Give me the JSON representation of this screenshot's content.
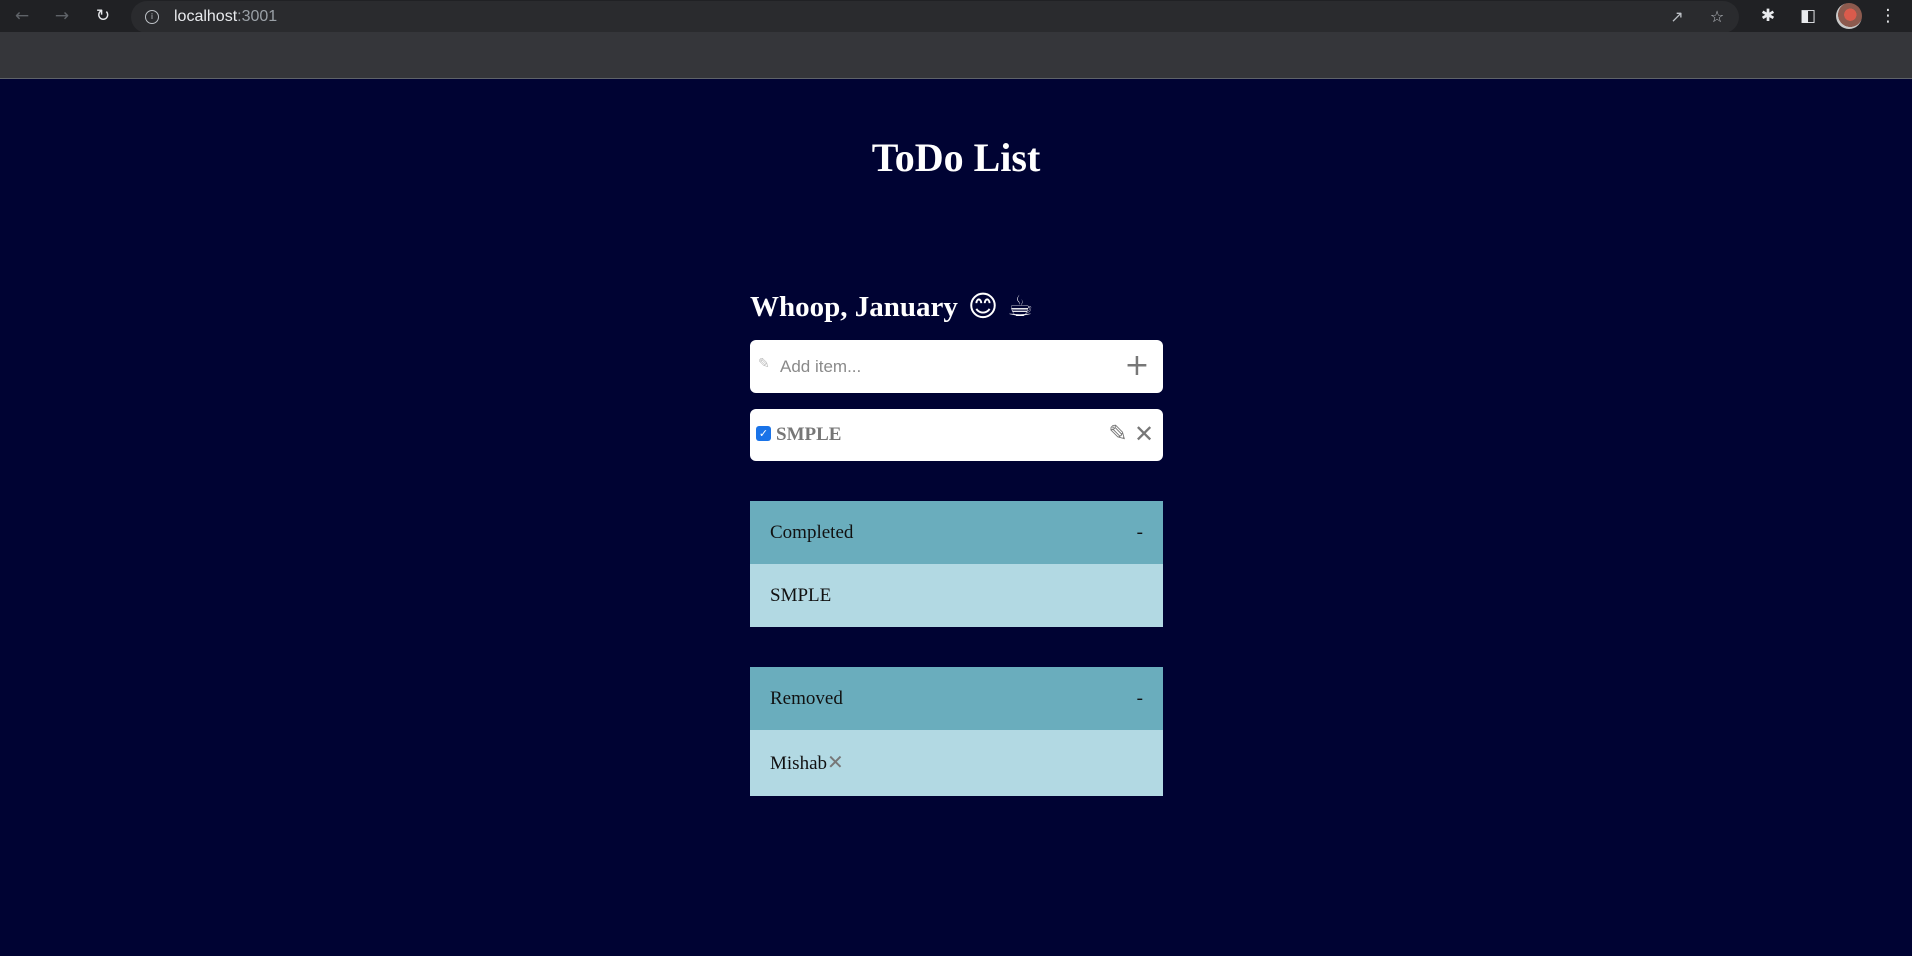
{
  "browser": {
    "url_host": "localhost",
    "url_port": ":3001",
    "icons": [
      "back-arrow-icon",
      "forward-arrow-icon",
      "reload-icon",
      "info-icon",
      "share-icon",
      "star-icon",
      "extensions-icon",
      "side-panel-icon",
      "profile-avatar",
      "menu-icon"
    ]
  },
  "page": {
    "title": "ToDo List",
    "greeting": "Whoop, January",
    "greeting_emoji": "😊 ☕",
    "background": "#000333"
  },
  "add": {
    "placeholder": "Add item..."
  },
  "items": [
    {
      "label": "SMPLE",
      "checked": true
    }
  ],
  "completed": {
    "title": "Completed",
    "toggle": "-",
    "items": [
      "SMPLE"
    ]
  },
  "removed": {
    "title": "Removed",
    "toggle": "-",
    "items": [
      "Mishab"
    ]
  },
  "colors": {
    "section_header": "#6aadbd",
    "section_row": "#b2d9e3",
    "checkbox": "#1a73e8"
  }
}
